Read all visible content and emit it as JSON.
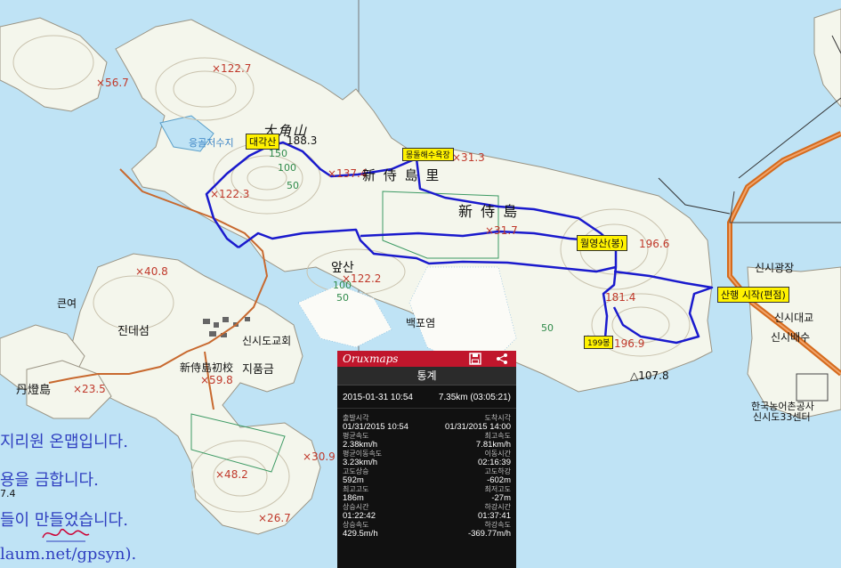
{
  "map": {
    "labels": {
      "daegaksan_hanja": "大角山",
      "daegaksan_tag": "대각산",
      "peak_1883": "188.3",
      "elev_567": "×56.7",
      "elev_1227": "×122.7",
      "reservoir": "응골저수지",
      "elev_1223": "×122.3",
      "elev_150": "150",
      "elev_100a": "100",
      "elev_50a": "50",
      "elev_1374": "×137.4",
      "sinsido_ri": "新 侍 島 里",
      "beach_tag": "몽돌해수욕장",
      "elev_313": "×31.3",
      "sinsido": "新 侍 島",
      "elev_317": "×31.7",
      "wolyeongsan_tag": "월영산(봉)",
      "elev_1966": "196.6",
      "apsan": "앞산",
      "elev_1222": "×122.2",
      "elev_100b": "100",
      "elev_50b": "50",
      "baekpogeom": "백포염",
      "elev_408": "×40.8",
      "keunyeo": "큰여",
      "jindeseom": "진데섬",
      "church": "신시도교회",
      "school": "新侍島初校",
      "jipumgeum": "지품금",
      "dandeungdo": "丹燈島",
      "elev_235": "×23.5",
      "elev_598": "×59.8",
      "elev_482": "×48.2",
      "elev_309": "×30.9",
      "elev_267": "×26.7",
      "elev_1814": "181.4",
      "peak199_tag": "199봉",
      "elev_1969": "196.9",
      "elev_50c": "50",
      "elev_1078": "△107.8",
      "sinsi_plaza": "신시광장",
      "start_tag": "산행 시작(편점)",
      "sinsi_bridge": "신시대교",
      "sinsi_baesu": "신시배수",
      "korea_rural": "한국농어촌공사",
      "center33": "신시도33센터"
    },
    "watermark": {
      "line1": "지리원 온맵입니다.",
      "line2": "용을 금합니다.",
      "line3": "들이 만들었습니다.",
      "line4": "laum.net/gpsyn).",
      "stub": "7.4"
    },
    "colors": {
      "sea": "#bfe3f5",
      "land": "#f4f6ec",
      "contour": "#c9c2ad",
      "track": "#1a1acd",
      "road": "#c8692f",
      "elevation_text": "#c0392b"
    }
  },
  "panel": {
    "app_name": "Oruxmaps",
    "title": "통계",
    "date": "2015-01-31 10:54",
    "distance": "7.35km (03:05:21)",
    "stats": [
      {
        "lk": "출발시각",
        "lv": "01/31/2015 10:54",
        "rk": "도착시각",
        "rv": "01/31/2015 14:00"
      },
      {
        "lk": "평균속도",
        "lv": "2.38km/h",
        "rk": "최고속도",
        "rv": "7.81km/h"
      },
      {
        "lk": "평균이동속도",
        "lv": "3.23km/h",
        "rk": "이동시간",
        "rv": "02:16:39"
      },
      {
        "lk": "고도상승",
        "lv": "592m",
        "rk": "고도하강",
        "rv": "-602m"
      },
      {
        "lk": "최고고도",
        "lv": "186m",
        "rk": "최저고도",
        "rv": "-27m"
      },
      {
        "lk": "상승시간",
        "lv": "01:22:42",
        "rk": "하강시간",
        "rv": "01:37:41"
      },
      {
        "lk": "상승속도",
        "lv": "429.5m/h",
        "rk": "하강속도",
        "rv": "-369.77m/h"
      }
    ],
    "icons": {
      "save": "save-icon",
      "share": "share-icon"
    }
  }
}
